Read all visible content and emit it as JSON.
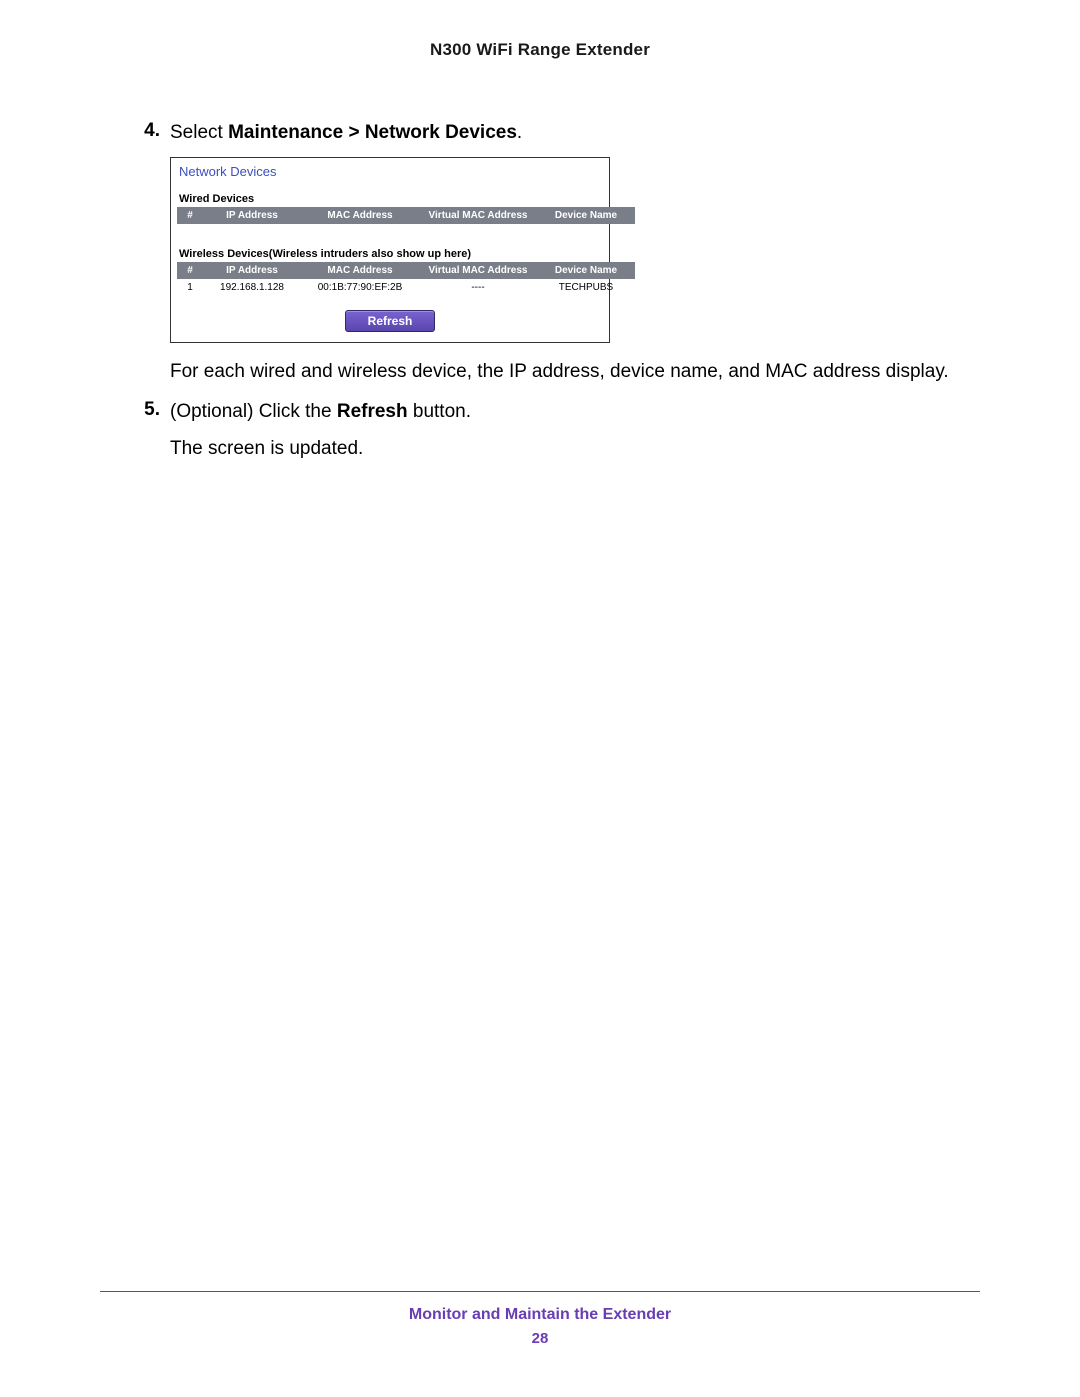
{
  "header": {
    "title": "N300 WiFi Range Extender"
  },
  "steps": {
    "s4": {
      "num": "4.",
      "pre": "Select ",
      "bold": "Maintenance > Network Devices",
      "post": "."
    },
    "s4_note": "For each wired and wireless device, the IP address, device name, and MAC address display.",
    "s5": {
      "num": "5.",
      "pre": "(Optional) Click the ",
      "bold": "Refresh",
      "post": " button."
    },
    "s5_note": "The screen is updated."
  },
  "panel": {
    "title": "Network Devices",
    "wired_label": "Wired Devices",
    "wireless_label": "Wireless Devices(Wireless intruders also show up here)",
    "col": {
      "num": "#",
      "ip": "IP Address",
      "mac": "MAC Address",
      "vmac": "Virtual MAC Address",
      "name": "Device Name"
    },
    "wireless_rows": [
      {
        "num": "1",
        "ip": "192.168.1.128",
        "mac": "00:1B:77:90:EF:2B",
        "vmac": "----",
        "name": "TECHPUBS"
      }
    ],
    "refresh": "Refresh"
  },
  "footer": {
    "title": "Monitor and Maintain the Extender",
    "page": "28"
  }
}
